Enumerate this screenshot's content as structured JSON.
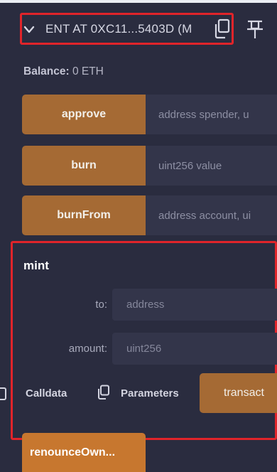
{
  "contract": {
    "title": "ENT AT 0XC11...5403D (M"
  },
  "balance": {
    "label": "Balance:",
    "value": "0 ETH"
  },
  "functions": [
    {
      "label": "approve",
      "placeholder": "address spender, u"
    },
    {
      "label": "burn",
      "placeholder": "uint256 value"
    },
    {
      "label": "burnFrom",
      "placeholder": "address account, ui"
    }
  ],
  "mint": {
    "title": "mint",
    "args": [
      {
        "label": "to:",
        "placeholder": "address"
      },
      {
        "label": "amount:",
        "placeholder": "uint256"
      }
    ],
    "calldata_label": "Calldata",
    "parameters_label": "Parameters",
    "transact_label": "transact"
  },
  "renounce": {
    "label": "renounceOwn..."
  },
  "colors": {
    "background": "#2a2c3f",
    "button": "#a56a34",
    "input": "#33354a",
    "highlight": "#e0242a"
  }
}
